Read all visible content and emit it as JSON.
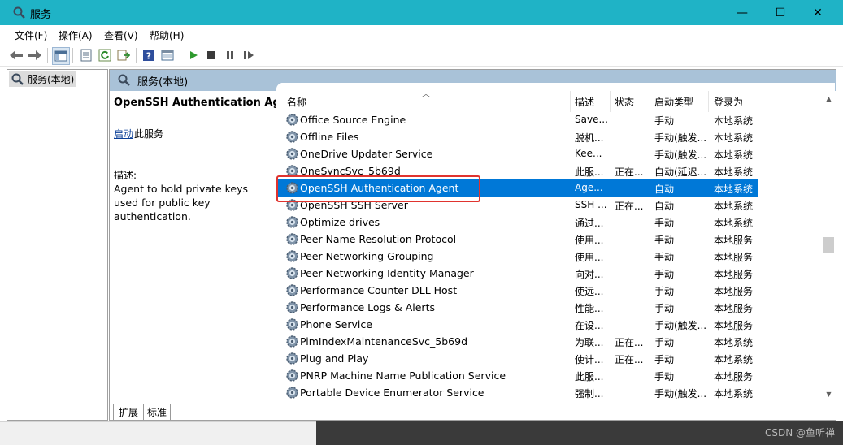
{
  "window": {
    "title": "服务",
    "minimize_glyph": "—",
    "maximize_glyph": "☐",
    "close_glyph": "✕"
  },
  "menu": [
    "文件(F)",
    "操作(A)",
    "查看(V)",
    "帮助(H)"
  ],
  "toolbar_icons": [
    "back-icon",
    "forward-icon",
    "console-tree-icon",
    "properties-icon",
    "refresh-icon",
    "export-icon",
    "help-icon",
    "view-icon",
    "start-icon",
    "stop-icon",
    "pause-icon",
    "restart-icon"
  ],
  "tree": {
    "item": "服务(本地)"
  },
  "panel": {
    "header": "服务(本地)",
    "selected_title": "OpenSSH Authentication Agent",
    "start_link": "启动",
    "start_rest": "此服务",
    "desc_label": "描述:",
    "desc_text": "Agent to hold private keys used for public key authentication."
  },
  "list": {
    "columns": {
      "name": "名称",
      "desc": "描述",
      "status": "状态",
      "startup": "启动类型",
      "logon": "登录为"
    },
    "rows": [
      {
        "name": "Office  Source Engine",
        "desc": "Save...",
        "status": "",
        "startup": "手动",
        "logon": "本地系统"
      },
      {
        "name": "Offline Files",
        "desc": "脱机...",
        "status": "",
        "startup": "手动(触发...",
        "logon": "本地系统"
      },
      {
        "name": "OneDrive Updater Service",
        "desc": "Kee...",
        "status": "",
        "startup": "手动(触发...",
        "logon": "本地系统"
      },
      {
        "name": "OneSyncSvc_5b69d",
        "desc": "此服...",
        "status": "正在...",
        "startup": "自动(延迟...",
        "logon": "本地系统"
      },
      {
        "name": "OpenSSH Authentication Agent",
        "desc": "Age...",
        "status": "",
        "startup": "自动",
        "logon": "本地系统",
        "selected": true
      },
      {
        "name": "OpenSSH SSH Server",
        "desc": "SSH ...",
        "status": "正在...",
        "startup": "自动",
        "logon": "本地系统"
      },
      {
        "name": "Optimize drives",
        "desc": "通过...",
        "status": "",
        "startup": "手动",
        "logon": "本地系统"
      },
      {
        "name": "Peer Name Resolution Protocol",
        "desc": "使用...",
        "status": "",
        "startup": "手动",
        "logon": "本地服务"
      },
      {
        "name": "Peer Networking Grouping",
        "desc": "使用...",
        "status": "",
        "startup": "手动",
        "logon": "本地服务"
      },
      {
        "name": "Peer Networking Identity Manager",
        "desc": "向对...",
        "status": "",
        "startup": "手动",
        "logon": "本地服务"
      },
      {
        "name": "Performance Counter DLL Host",
        "desc": "使远...",
        "status": "",
        "startup": "手动",
        "logon": "本地服务"
      },
      {
        "name": "Performance Logs & Alerts",
        "desc": "性能...",
        "status": "",
        "startup": "手动",
        "logon": "本地服务"
      },
      {
        "name": "Phone Service",
        "desc": "在设...",
        "status": "",
        "startup": "手动(触发...",
        "logon": "本地服务"
      },
      {
        "name": "PimIndexMaintenanceSvc_5b69d",
        "desc": "为联...",
        "status": "正在...",
        "startup": "手动",
        "logon": "本地系统"
      },
      {
        "name": "Plug and Play",
        "desc": "使计...",
        "status": "正在...",
        "startup": "手动",
        "logon": "本地系统"
      },
      {
        "name": "PNRP Machine Name Publication Service",
        "desc": "此服...",
        "status": "",
        "startup": "手动",
        "logon": "本地服务"
      },
      {
        "name": "Portable Device Enumerator Service",
        "desc": "强制...",
        "status": "",
        "startup": "手动(触发...",
        "logon": "本地系统"
      }
    ]
  },
  "tabs": {
    "extended": "扩展",
    "standard": "标准"
  },
  "watermark": "CSDN @鱼听禅",
  "colors": {
    "titlebar": "#1fb3c6",
    "selection": "#0078d7",
    "panel_header": "#a9c2d8",
    "highlight": "#e0332e"
  }
}
